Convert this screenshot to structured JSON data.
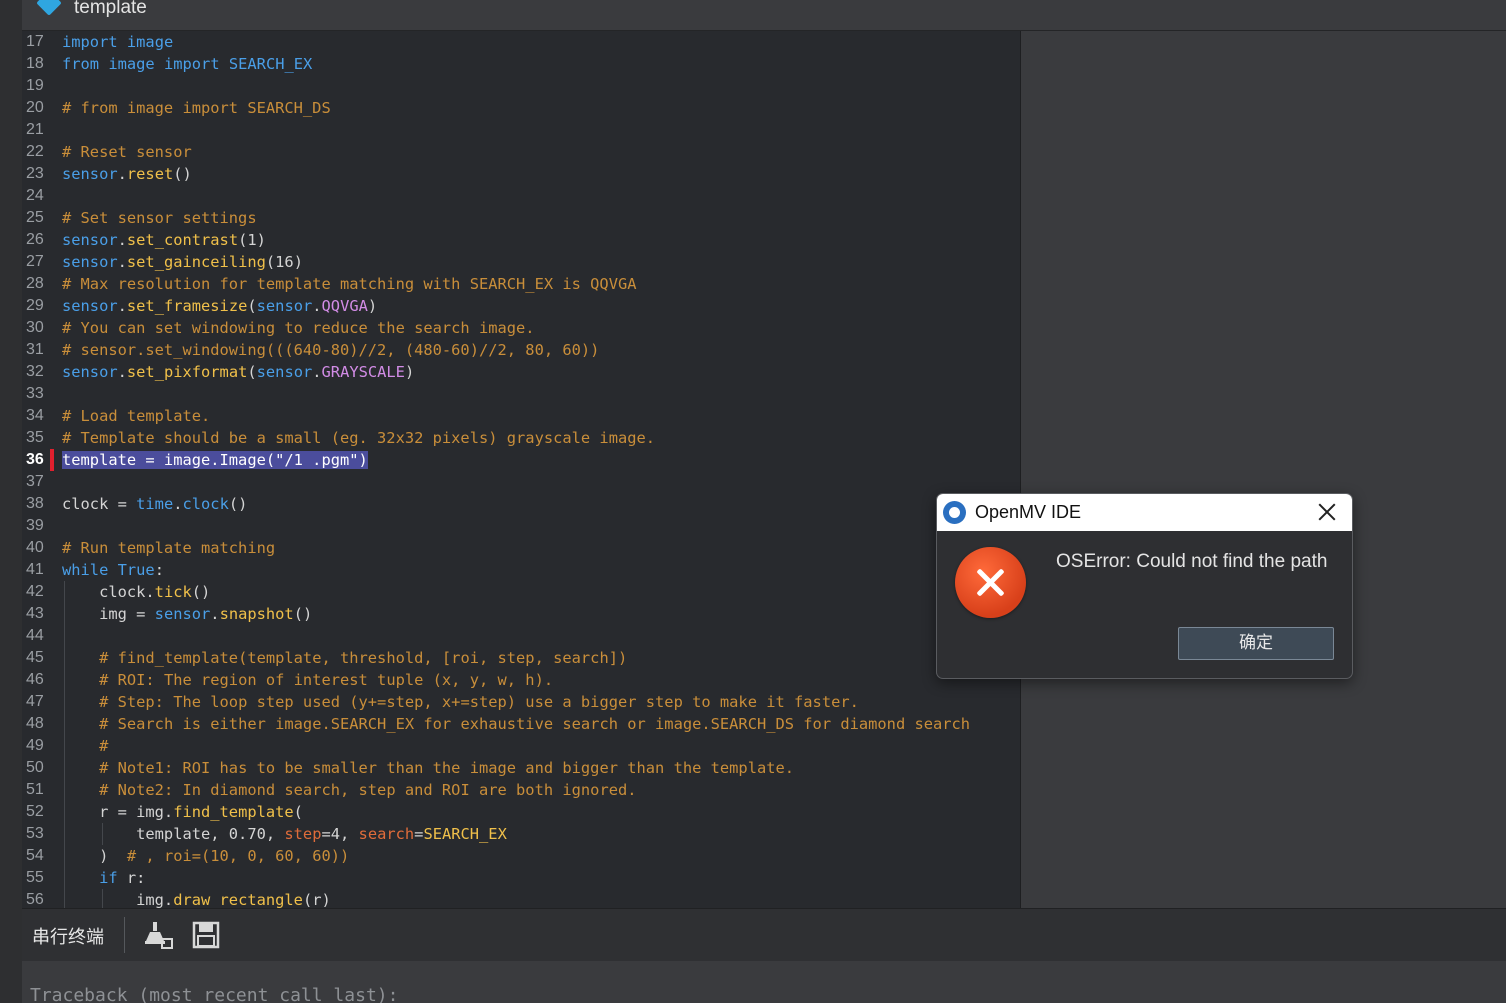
{
  "window": {
    "tab_title": "template"
  },
  "editor": {
    "current_line": 36,
    "lines": [
      {
        "n": "17",
        "tokens": [
          {
            "t": "import",
            "c": "kw"
          },
          {
            "t": " "
          },
          {
            "t": "image",
            "c": "id"
          }
        ]
      },
      {
        "n": "18",
        "tokens": [
          {
            "t": "from",
            "c": "kw"
          },
          {
            "t": " "
          },
          {
            "t": "image",
            "c": "id"
          },
          {
            "t": " "
          },
          {
            "t": "import",
            "c": "kw"
          },
          {
            "t": " "
          },
          {
            "t": "SEARCH_EX",
            "c": "id"
          }
        ]
      },
      {
        "n": "19",
        "tokens": []
      },
      {
        "n": "20",
        "tokens": [
          {
            "t": "# from image import SEARCH_DS",
            "c": "cm"
          }
        ]
      },
      {
        "n": "21",
        "tokens": []
      },
      {
        "n": "22",
        "tokens": [
          {
            "t": "# Reset sensor",
            "c": "cm"
          }
        ]
      },
      {
        "n": "23",
        "tokens": [
          {
            "t": "sensor",
            "c": "id"
          },
          {
            "t": "."
          },
          {
            "t": "reset",
            "c": "fn"
          },
          {
            "t": "()"
          }
        ]
      },
      {
        "n": "24",
        "tokens": []
      },
      {
        "n": "25",
        "tokens": [
          {
            "t": "# Set sensor settings",
            "c": "cm"
          }
        ]
      },
      {
        "n": "26",
        "tokens": [
          {
            "t": "sensor",
            "c": "id"
          },
          {
            "t": "."
          },
          {
            "t": "set_contrast",
            "c": "fn"
          },
          {
            "t": "(1)"
          }
        ]
      },
      {
        "n": "27",
        "tokens": [
          {
            "t": "sensor",
            "c": "id"
          },
          {
            "t": "."
          },
          {
            "t": "set_gainceiling",
            "c": "fn"
          },
          {
            "t": "(16)"
          }
        ]
      },
      {
        "n": "28",
        "tokens": [
          {
            "t": "# Max resolution for template matching with SEARCH_EX is QQVGA",
            "c": "cm"
          }
        ]
      },
      {
        "n": "29",
        "tokens": [
          {
            "t": "sensor",
            "c": "id"
          },
          {
            "t": "."
          },
          {
            "t": "set_framesize",
            "c": "fn"
          },
          {
            "t": "("
          },
          {
            "t": "sensor",
            "c": "id"
          },
          {
            "t": "."
          },
          {
            "t": "QQVGA",
            "c": "cn"
          },
          {
            "t": ")"
          }
        ]
      },
      {
        "n": "30",
        "tokens": [
          {
            "t": "# You can set windowing to reduce the search image.",
            "c": "cm"
          }
        ]
      },
      {
        "n": "31",
        "tokens": [
          {
            "t": "# sensor.set_windowing(((640-80)//2, (480-60)//2, 80, 60))",
            "c": "cm"
          }
        ]
      },
      {
        "n": "32",
        "tokens": [
          {
            "t": "sensor",
            "c": "id"
          },
          {
            "t": "."
          },
          {
            "t": "set_pixformat",
            "c": "fn"
          },
          {
            "t": "("
          },
          {
            "t": "sensor",
            "c": "id"
          },
          {
            "t": "."
          },
          {
            "t": "GRAYSCALE",
            "c": "cn"
          },
          {
            "t": ")"
          }
        ]
      },
      {
        "n": "33",
        "tokens": []
      },
      {
        "n": "34",
        "tokens": [
          {
            "t": "# Load template.",
            "c": "cm"
          }
        ]
      },
      {
        "n": "35",
        "tokens": [
          {
            "t": "# Template should be a small (eg. 32x32 pixels) grayscale image.",
            "c": "cm"
          }
        ]
      },
      {
        "n": "36",
        "tokens": [
          {
            "t": "template = image.Image(\"/1 .pgm\")",
            "c": "hl"
          }
        ]
      },
      {
        "n": "37",
        "tokens": []
      },
      {
        "n": "38",
        "tokens": [
          {
            "t": "clock = "
          },
          {
            "t": "time",
            "c": "id"
          },
          {
            "t": "."
          },
          {
            "t": "clock",
            "c": "id"
          },
          {
            "t": "()"
          }
        ]
      },
      {
        "n": "39",
        "tokens": []
      },
      {
        "n": "40",
        "tokens": [
          {
            "t": "# Run template matching",
            "c": "cm"
          }
        ]
      },
      {
        "n": "41",
        "tokens": [
          {
            "t": "while",
            "c": "kw"
          },
          {
            "t": " "
          },
          {
            "t": "True",
            "c": "kw"
          },
          {
            "t": ":"
          }
        ]
      },
      {
        "n": "42",
        "tokens": [
          {
            "t": "    clock."
          },
          {
            "t": "tick",
            "c": "fn"
          },
          {
            "t": "()"
          }
        ]
      },
      {
        "n": "43",
        "tokens": [
          {
            "t": "    img = "
          },
          {
            "t": "sensor",
            "c": "id"
          },
          {
            "t": "."
          },
          {
            "t": "snapshot",
            "c": "fn"
          },
          {
            "t": "()"
          }
        ]
      },
      {
        "n": "44",
        "tokens": []
      },
      {
        "n": "45",
        "tokens": [
          {
            "t": "    "
          },
          {
            "t": "# find_template(template, threshold, [roi, step, search])",
            "c": "cm"
          }
        ]
      },
      {
        "n": "46",
        "tokens": [
          {
            "t": "    "
          },
          {
            "t": "# ROI: The region of interest tuple (x, y, w, h).",
            "c": "cm"
          }
        ]
      },
      {
        "n": "47",
        "tokens": [
          {
            "t": "    "
          },
          {
            "t": "# Step: The loop step used (y+=step, x+=step) use a bigger step to make it faster.",
            "c": "cm"
          }
        ]
      },
      {
        "n": "48",
        "tokens": [
          {
            "t": "    "
          },
          {
            "t": "# Search is either image.SEARCH_EX for exhaustive search or image.SEARCH_DS for diamond search",
            "c": "cm"
          }
        ]
      },
      {
        "n": "49",
        "tokens": [
          {
            "t": "    "
          },
          {
            "t": "#",
            "c": "cm"
          }
        ]
      },
      {
        "n": "50",
        "tokens": [
          {
            "t": "    "
          },
          {
            "t": "# Note1: ROI has to be smaller than the image and bigger than the template.",
            "c": "cm"
          }
        ]
      },
      {
        "n": "51",
        "tokens": [
          {
            "t": "    "
          },
          {
            "t": "# Note2: In diamond search, step and ROI are both ignored.",
            "c": "cm"
          }
        ]
      },
      {
        "n": "52",
        "tokens": [
          {
            "t": "    r = img."
          },
          {
            "t": "find_template",
            "c": "fn"
          },
          {
            "t": "("
          }
        ]
      },
      {
        "n": "53",
        "tokens": [
          {
            "t": "        template, 0.70, "
          },
          {
            "t": "step",
            "c": "pr"
          },
          {
            "t": "=4, "
          },
          {
            "t": "search",
            "c": "pr"
          },
          {
            "t": "="
          },
          {
            "t": "SEARCH_EX",
            "c": "fn"
          }
        ]
      },
      {
        "n": "54",
        "tokens": [
          {
            "t": "    )  "
          },
          {
            "t": "# , roi=(10, 0, 60, 60))",
            "c": "cm"
          }
        ]
      },
      {
        "n": "55",
        "tokens": [
          {
            "t": "    "
          },
          {
            "t": "if",
            "c": "kw"
          },
          {
            "t": " r:"
          }
        ]
      },
      {
        "n": "56",
        "tokens": [
          {
            "t": "        img."
          },
          {
            "t": "draw_rectangle",
            "c": "fn"
          },
          {
            "t": "(r)"
          }
        ]
      }
    ]
  },
  "terminal": {
    "label": "串行终端",
    "output": "Traceback (most recent call last):",
    "tools": [
      "clear-icon",
      "save-icon"
    ]
  },
  "dialog": {
    "title": "OpenMV IDE",
    "message": "OSError: Could not find the path",
    "ok_label": "确定"
  }
}
